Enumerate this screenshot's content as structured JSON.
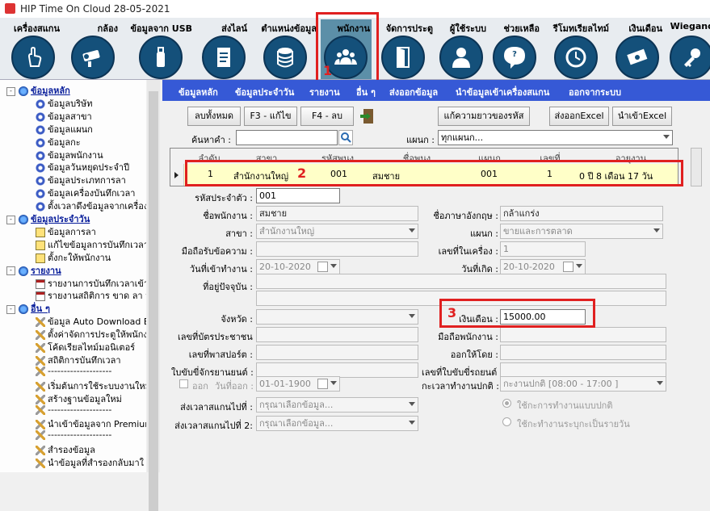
{
  "window": {
    "title": "HIP Time On Cloud 28-05-2021"
  },
  "toolbar": [
    {
      "label": "เครื่องสแกน",
      "icon": "hand-touch-icon"
    },
    {
      "label": "กล้อง",
      "icon": "camera-icon"
    },
    {
      "label": "ข้อมูลจาก USB",
      "icon": "usb-icon"
    },
    {
      "label": "ส่งไลน์",
      "icon": "document-icon"
    },
    {
      "label": "ตำแหน่งข้อมูล",
      "icon": "database-icon"
    },
    {
      "label": "พนักงาน",
      "icon": "people-icon"
    },
    {
      "label": "จัดการประตู",
      "icon": "door-icon"
    },
    {
      "label": "ผู้ใช้ระบบ",
      "icon": "user-icon"
    },
    {
      "label": "ช่วยเหลือ",
      "icon": "help-icon"
    },
    {
      "label": "รีโมทเรียลไทม์",
      "icon": "clock-icon"
    },
    {
      "label": "เงินเดือน",
      "icon": "money-icon"
    },
    {
      "label": "Wiegand",
      "icon": "key-icon"
    }
  ],
  "tree": [
    {
      "label": "ข้อมูลหลัก",
      "type": "cat",
      "icon": "globe-icon",
      "indent": 0
    },
    {
      "label": "ข้อมูลบริษัท",
      "type": "item",
      "icon": "gear-icon",
      "indent": 1
    },
    {
      "label": "ข้อมูลสาขา",
      "type": "item",
      "icon": "gear-icon",
      "indent": 1
    },
    {
      "label": "ข้อมูลแผนก",
      "type": "item",
      "icon": "gear-icon",
      "indent": 1
    },
    {
      "label": "ข้อมูลกะ",
      "type": "item",
      "icon": "gear-icon",
      "indent": 1
    },
    {
      "label": "ข้อมูลพนักงาน",
      "type": "item",
      "icon": "gear-icon",
      "indent": 1
    },
    {
      "label": "ข้อมูลวันหยุดประจำปี",
      "type": "item",
      "icon": "gear-icon",
      "indent": 1
    },
    {
      "label": "ข้อมูลประเภทการลา",
      "type": "item",
      "icon": "gear-icon",
      "indent": 1
    },
    {
      "label": "ข้อมูลเครื่องบันทึกเวลา",
      "type": "item",
      "icon": "gear-icon",
      "indent": 1
    },
    {
      "label": "ตั้งเวลาดึงข้อมูลจากเครื่อง",
      "type": "item",
      "icon": "gear-icon",
      "indent": 1
    },
    {
      "label": "ข้อมูลประจำวัน",
      "type": "cat",
      "icon": "globe-icon",
      "indent": 0
    },
    {
      "label": "ข้อมูลการลา",
      "type": "item",
      "icon": "sq-icon",
      "indent": 1
    },
    {
      "label": "แก้ไขข้อมูลการบันทึกเวลา",
      "type": "item",
      "icon": "sq-icon",
      "indent": 1
    },
    {
      "label": "ตั้งกะให้พนักงาน",
      "type": "item",
      "icon": "sq-icon",
      "indent": 1
    },
    {
      "label": "รายงาน",
      "type": "cat",
      "icon": "globe-icon",
      "indent": 0
    },
    {
      "label": "รายงานการบันทึกเวลาเข้า-",
      "type": "item",
      "icon": "doc-icon",
      "indent": 1
    },
    {
      "label": "รายงานสถิติการ ขาด ลา ม",
      "type": "item",
      "icon": "doc-icon",
      "indent": 1
    },
    {
      "label": "อื่น ๆ",
      "type": "cat",
      "icon": "globe-icon",
      "indent": 0
    },
    {
      "label": "ข้อมูล Auto Download Er",
      "type": "item",
      "icon": "tool-icon",
      "indent": 1
    },
    {
      "label": "ตั้งค่าจัดการประตูให้พนักงา",
      "type": "item",
      "icon": "tool-icon",
      "indent": 1
    },
    {
      "label": "โค้ดเรียลไทม์มอนิเตอร์",
      "type": "item",
      "icon": "tool-icon",
      "indent": 1
    },
    {
      "label": "สถิติการบันทึกเวลา",
      "type": "item",
      "icon": "tool-icon",
      "indent": 1
    },
    {
      "label": "--------------------",
      "type": "item",
      "icon": "tool-icon",
      "indent": 1
    },
    {
      "label": "เริ่มต้นการใช้ระบบงานใหม่",
      "type": "item",
      "icon": "tool-icon",
      "indent": 1
    },
    {
      "label": "สร้างฐานข้อมูลใหม่",
      "type": "item",
      "icon": "tool-icon",
      "indent": 1
    },
    {
      "label": "--------------------",
      "type": "item",
      "icon": "tool-icon",
      "indent": 1
    },
    {
      "label": "นำเข้าข้อมูลจาก Premium",
      "type": "item",
      "icon": "tool-icon",
      "indent": 1
    },
    {
      "label": "--------------------",
      "type": "item",
      "icon": "tool-icon",
      "indent": 1
    },
    {
      "label": "สำรองข้อมูล",
      "type": "item",
      "icon": "tool-icon",
      "indent": 1
    },
    {
      "label": "นำข้อมูลที่สำรองกลับมาใ",
      "type": "item",
      "icon": "tool-icon",
      "indent": 1
    }
  ],
  "menubar": [
    "ข้อมูลหลัก",
    "ข้อมูลประจำวัน",
    "รายงาน",
    "อื่น ๆ",
    "ส่งออกข้อมูล",
    "นำข้อมูลเข้าเครื่องสแกน",
    "ออกจากระบบ"
  ],
  "buttons": {
    "delete_all": "ลบทั้งหมด",
    "edit": "F3 - แก้ไข",
    "delete": "F4 - ลบ",
    "fix_length": "แก้ความยาวของรหัส",
    "export_excel": "ส่งออกExcel",
    "import_excel": "นำเข้าExcel"
  },
  "search": {
    "label": "ค้นหาคำ :",
    "value": ""
  },
  "department_filter": {
    "label": "แผนก :",
    "value": "ทุกแผนก..."
  },
  "grid": {
    "columns": [
      "ลำดับ",
      "สาขา",
      "รหัสพนง",
      "ชื่อพนง",
      "แผนก",
      "เลขที่",
      "อายุงาน"
    ],
    "rows": [
      {
        "no": "1",
        "branch": "สำนักงานใหญ่",
        "emp_code": "001",
        "name": "สมชาย",
        "dept": "001",
        "number": "1",
        "tenure": "0 ปี 8 เดือน 17 วัน"
      }
    ]
  },
  "form": {
    "emp_id": {
      "label": "รหัสประจำตัว :",
      "value": "001"
    },
    "name": {
      "label": "ชื่อพนักงาน :",
      "value": "สมชาย"
    },
    "eng_name": {
      "label": "ชื่อภาษาอังกฤษ :",
      "value": "กล้าแกร่ง"
    },
    "branch": {
      "label": "สาขา :",
      "value": "สำนักงานใหญ่"
    },
    "dept": {
      "label": "แผนก :",
      "value": "ขายและการตลาด"
    },
    "mobile": {
      "label": "มือถือรับข้อความ :",
      "value": ""
    },
    "machine_no": {
      "label": "เลขที่ในเครื่อง :",
      "value": "1"
    },
    "start_date": {
      "label": "วันที่เข้าทำงาน :",
      "value": "20-10-2020"
    },
    "birth_date": {
      "label": "วันที่เกิด :",
      "value": "20-10-2020"
    },
    "address": {
      "label": "ที่อยู่ปัจจุบัน :",
      "value": ""
    },
    "province": {
      "label": "จังหวัด :",
      "value": ""
    },
    "salary": {
      "label": "เงินเดือน :",
      "value": "15000.00"
    },
    "id_card": {
      "label": "เลขที่บัตรประชาชน :",
      "value": ""
    },
    "account_no": {
      "label": "มือถือพนักงาน :",
      "value": ""
    },
    "passport": {
      "label": "เลขที่พาสปอร์ต :",
      "value": ""
    },
    "issued_by": {
      "label": "ออกให้โดย :",
      "value": ""
    },
    "driving_license": {
      "label": "ใบขับขี่จักรยานยนต์ :",
      "value": ""
    },
    "car_license": {
      "label": "เลขที่ใบขับขี่รถยนต์ :",
      "value": ""
    },
    "resign": {
      "label": "ออก",
      "date_label": "วันที่ออก :",
      "value": "01-01-1900"
    },
    "shift": {
      "label": "กะเวลาทำงานปกติ :",
      "value": "กะงานปกติ [08:00 - 17:00 ]"
    },
    "scan_to_1": {
      "label": "ส่งเวลาสแกนไปที่ :",
      "value": "กรุณาเลือกข้อมูล..."
    },
    "scan_to_2": {
      "label": "ส่งเวลาสแกนไปที่ 2:",
      "value": "กรุณาเลือกข้อมูล..."
    },
    "radio_normal": "ใช้กะการทำงานแบบปกติ",
    "radio_daily": "ใช้กะทำงานระบุกะเป็นรายวัน"
  },
  "annotations": [
    "1",
    "2",
    "3"
  ],
  "colors": {
    "menubar": "#3659d6",
    "highlight": "#e02020",
    "toolbar_icon": "#14507a",
    "row_selected": "#ffffc8"
  }
}
